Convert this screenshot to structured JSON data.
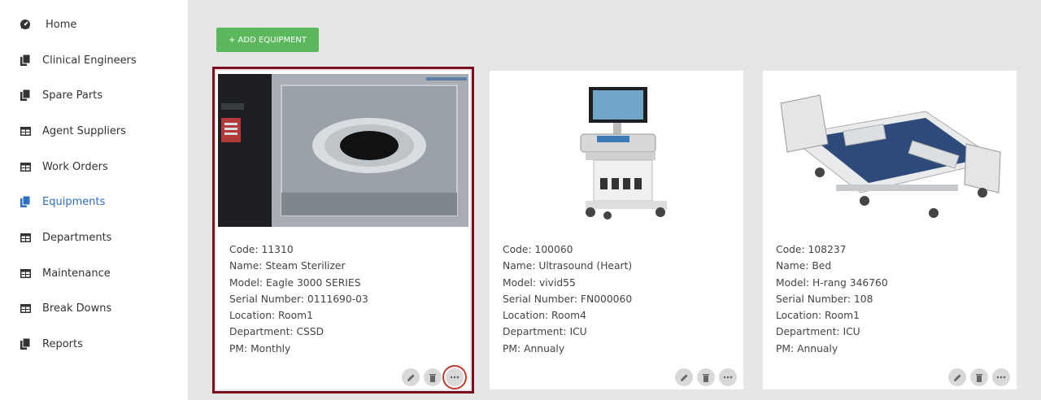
{
  "sidebar": {
    "items": [
      {
        "label": "Home",
        "icon": "dashboard-icon"
      },
      {
        "label": "Clinical Engineers",
        "icon": "copy-icon"
      },
      {
        "label": "Spare Parts",
        "icon": "copy-icon"
      },
      {
        "label": "Agent Suppliers",
        "icon": "table-icon"
      },
      {
        "label": "Work Orders",
        "icon": "table-icon"
      },
      {
        "label": "Equipments",
        "icon": "copy-icon",
        "active": true
      },
      {
        "label": "Departments",
        "icon": "table-icon"
      },
      {
        "label": "Maintenance",
        "icon": "table-icon"
      },
      {
        "label": "Break Downs",
        "icon": "table-icon"
      },
      {
        "label": "Reports",
        "icon": "copy-icon"
      }
    ]
  },
  "toolbar": {
    "add_label": "+ ADD EQUIPMENT"
  },
  "cards": [
    {
      "code": "Code: 11310",
      "name": "Name: Steam Sterilizer",
      "model": "Model: Eagle 3000 SERIES",
      "serial": "Serial Number: 0111690-03",
      "location": "Location: Room1",
      "department": "Department: CSSD",
      "pm": "PM: Monthly",
      "image": "steam-sterilizer"
    },
    {
      "code": "Code: 100060",
      "name": "Name: Ultrasound (Heart)",
      "model": "Model: vivid55",
      "serial": "Serial Number: FN000060",
      "location": "Location: Room4",
      "department": "Department: ICU",
      "pm": "PM: Annualy",
      "image": "ultrasound-machine"
    },
    {
      "code": "Code: 108237",
      "name": "Name: Bed",
      "model": "Model: H-rang 346760",
      "serial": "Serial Number: 108",
      "location": "Location: Room1",
      "department": "Department: ICU",
      "pm": "PM: Annualy",
      "image": "hospital-bed"
    }
  ],
  "colors": {
    "accent": "#2f6ec2",
    "add_button": "#5cb85c",
    "selected_outline": "#7a0f1e"
  }
}
